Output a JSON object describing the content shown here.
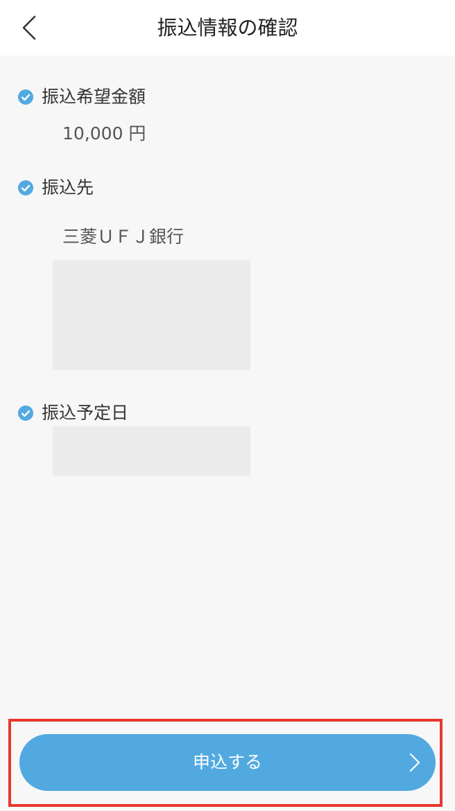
{
  "header": {
    "title": "振込情報の確認",
    "back_icon": "chevron-left-icon"
  },
  "sections": {
    "amount": {
      "label": "振込希望金額",
      "value": "10,000 円"
    },
    "recipient": {
      "label": "振込先",
      "value": "三菱ＵＦＪ銀行"
    },
    "schedule": {
      "label": "振込予定日"
    }
  },
  "submit": {
    "label": "申込する",
    "icon": "chevron-right-icon"
  },
  "colors": {
    "accent": "#52a9e0",
    "highlight_frame": "#e8372d",
    "background": "#f7f7f7",
    "placeholder": "#ececec"
  }
}
